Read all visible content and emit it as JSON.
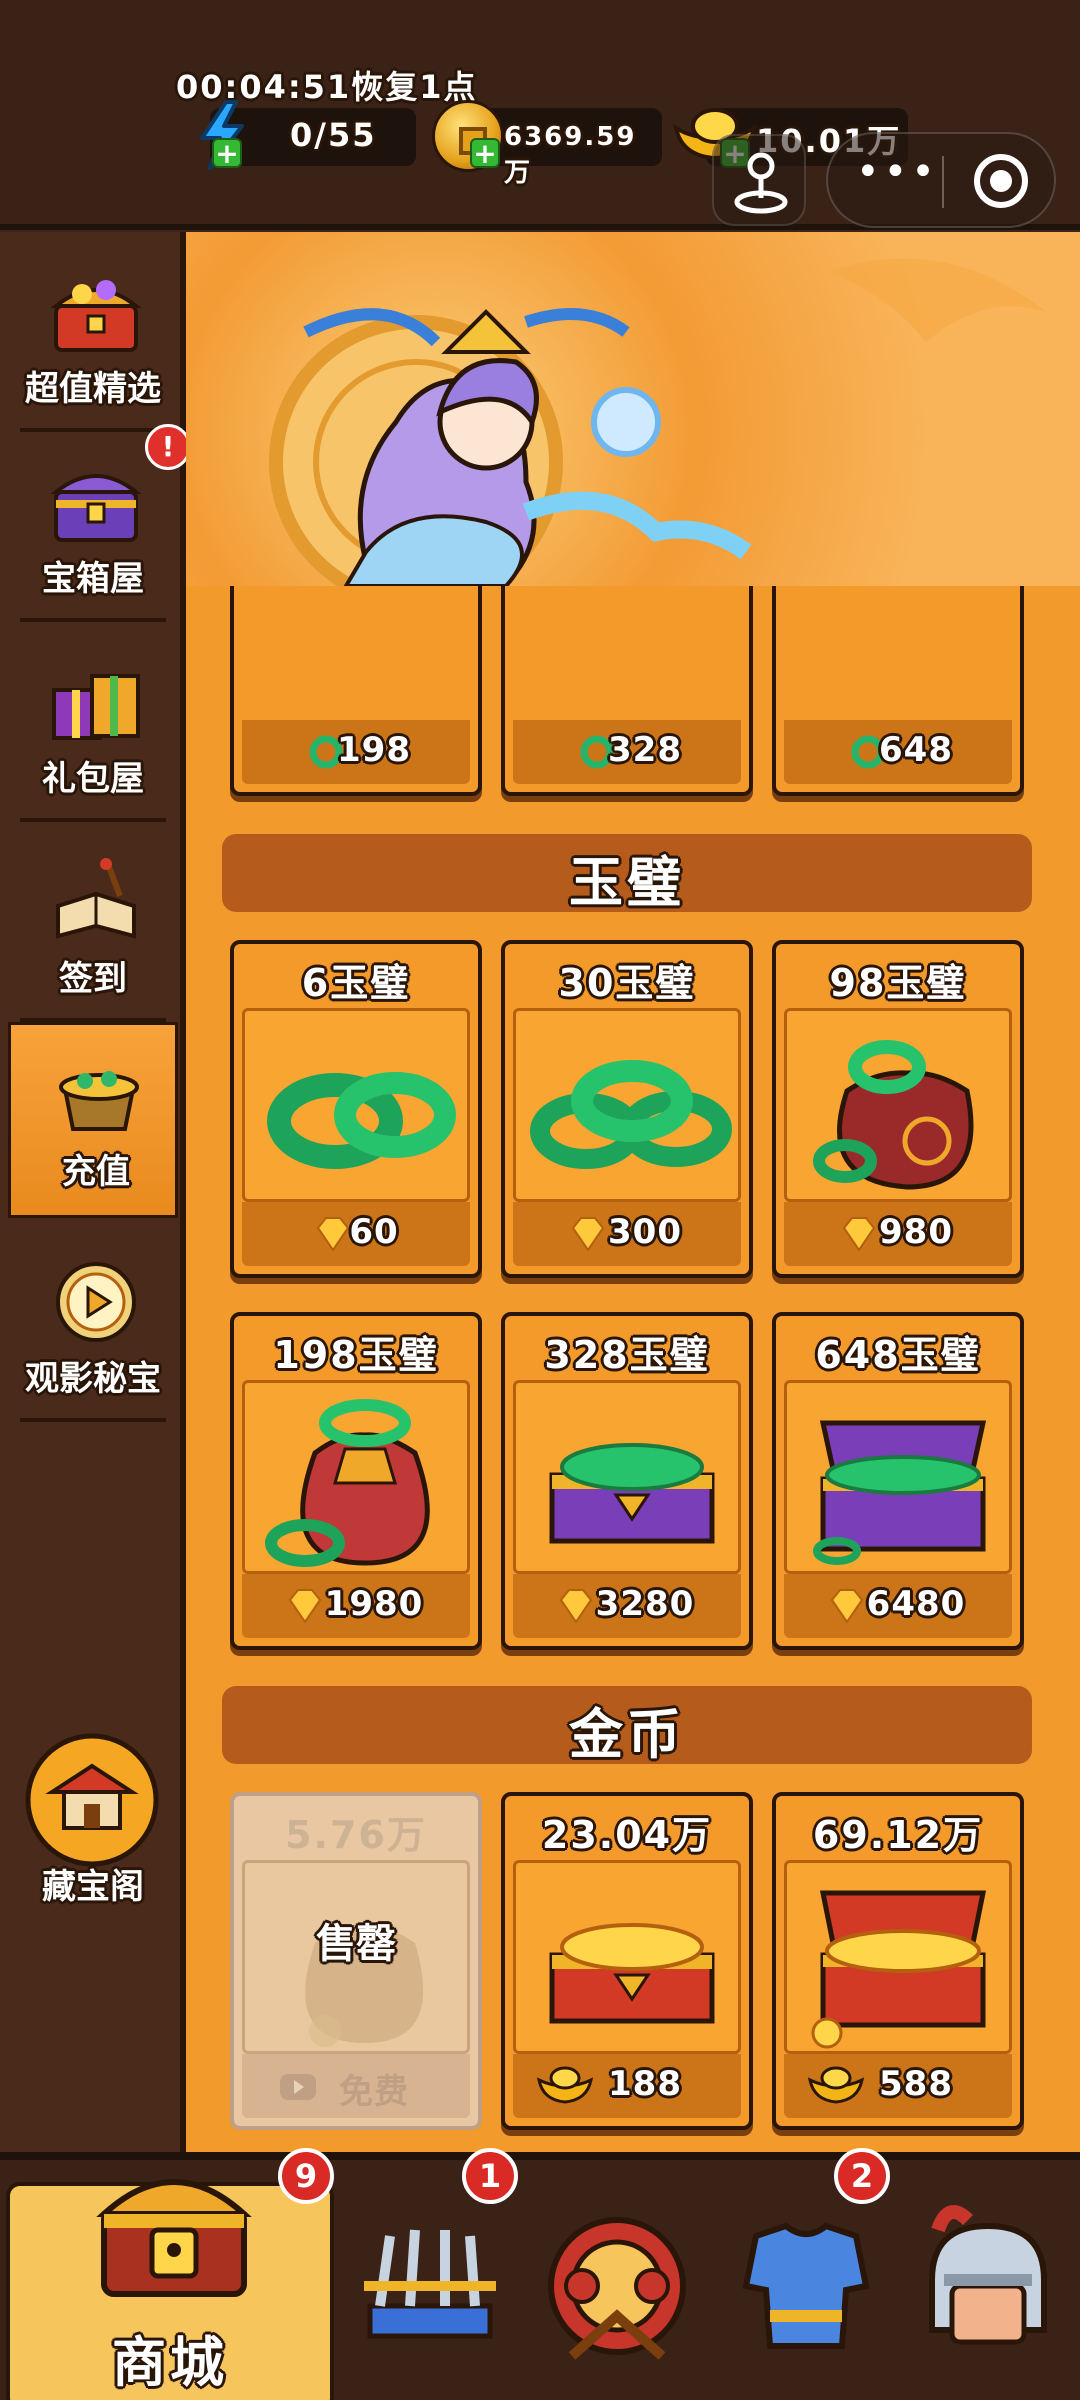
{
  "topbar": {
    "timer": "00:04:51恢复1点",
    "energy": "0/55",
    "coins": "6369.59万",
    "ingots": "10.01万"
  },
  "sidebar": {
    "items": [
      {
        "label": "超值精选",
        "icon": "treasure-chest-icon"
      },
      {
        "label": "宝箱屋",
        "icon": "purple-chest-icon"
      },
      {
        "label": "礼包屋",
        "icon": "gift-box-icon"
      },
      {
        "label": "签到",
        "icon": "scroll-book-icon"
      },
      {
        "label": "充值",
        "icon": "jade-pot-icon"
      },
      {
        "label": "观影秘宝",
        "icon": "video-play-icon"
      }
    ],
    "alert_badge": "!",
    "bottom_item": {
      "label": "藏宝阁",
      "icon": "pavilion-icon"
    }
  },
  "top_partial_row": {
    "prices": [
      "198",
      "328",
      "648"
    ],
    "currency_icon": "jade-icon"
  },
  "sections": {
    "jade": {
      "title": "玉璧",
      "items": [
        {
          "title": "6玉璧",
          "price": "60",
          "icon": "jade-pair-icon"
        },
        {
          "title": "30玉璧",
          "price": "300",
          "icon": "jade-pile-icon"
        },
        {
          "title": "98玉璧",
          "price": "980",
          "icon": "jade-bag-icon"
        },
        {
          "title": "198玉璧",
          "price": "1980",
          "icon": "jade-big-bag-icon"
        },
        {
          "title": "328玉璧",
          "price": "3280",
          "icon": "jade-box-icon"
        },
        {
          "title": "648玉璧",
          "price": "6480",
          "icon": "jade-chest-icon"
        }
      ],
      "currency_icon": "diamond-icon"
    },
    "gold": {
      "title": "金币",
      "items": [
        {
          "title": "5.76万",
          "sold_out": "售罄",
          "price": "免费",
          "icon": "coin-bag-icon",
          "currency_icon": "video-icon"
        },
        {
          "title": "23.04万",
          "price": "188",
          "icon": "coin-box-icon",
          "currency_icon": "ingot-icon"
        },
        {
          "title": "69.12万",
          "price": "588",
          "icon": "coin-chest-icon",
          "currency_icon": "ingot-icon"
        }
      ]
    }
  },
  "bottom_nav": {
    "shop_label": "商城",
    "badges": [
      "9",
      "1",
      "2"
    ]
  },
  "colors": {
    "main_bg": "#f29a2c",
    "card_price_bar": "#cc7418",
    "badge_red": "#d92a25",
    "outline": "#2a1608"
  }
}
